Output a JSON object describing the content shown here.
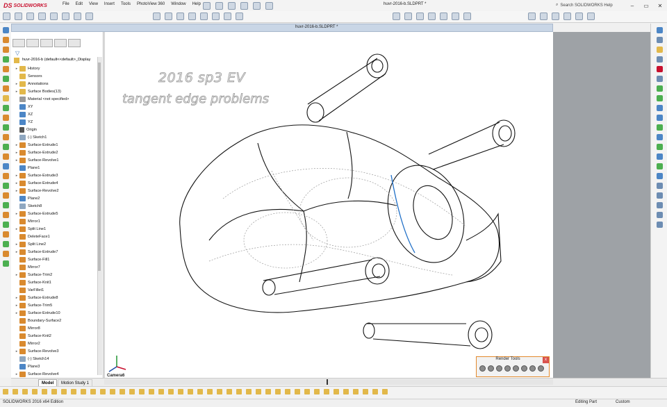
{
  "app": {
    "brand": "SOLIDWORKS",
    "brand_mark": "DS",
    "file_title": "huvr-2016-b.SLDPRT *"
  },
  "menu": [
    "File",
    "Edit",
    "View",
    "Insert",
    "Tools",
    "PhotoView 360",
    "Window",
    "Help"
  ],
  "search": {
    "placeholder": "Search SOLIDWORKS Help"
  },
  "window_controls": {
    "minimize": "–",
    "restore": "▭",
    "close": "✕"
  },
  "document": {
    "title": "huvr-2016-b.SLDPRT *"
  },
  "feature_tree": {
    "root": "huvr-2016-b (default<<default>_Display",
    "items": [
      {
        "label": "History",
        "icon": "folder",
        "expand": "▸"
      },
      {
        "label": "Sensors",
        "icon": "folder",
        "expand": ""
      },
      {
        "label": "Annotations",
        "icon": "folder",
        "expand": "▸"
      },
      {
        "label": "Surface Bodies(13)",
        "icon": "folder",
        "expand": "▸"
      },
      {
        "label": "Material <not specified>",
        "icon": "other",
        "expand": ""
      },
      {
        "label": "XY",
        "icon": "plane",
        "expand": ""
      },
      {
        "label": "XZ",
        "icon": "plane",
        "expand": ""
      },
      {
        "label": "YZ",
        "icon": "plane",
        "expand": ""
      },
      {
        "label": "Origin",
        "icon": "origin",
        "expand": ""
      },
      {
        "label": "(-) Sketch1",
        "icon": "sketch",
        "expand": ""
      },
      {
        "label": "Surface-Extrude1",
        "icon": "feat",
        "expand": "▸"
      },
      {
        "label": "Surface-Extrude2",
        "icon": "feat",
        "expand": "▸"
      },
      {
        "label": "Surface-Revolve1",
        "icon": "feat",
        "expand": "▸"
      },
      {
        "label": "Plane1",
        "icon": "plane",
        "expand": ""
      },
      {
        "label": "Surface-Extrude3",
        "icon": "feat",
        "expand": "▸"
      },
      {
        "label": "Surface-Extrude4",
        "icon": "feat",
        "expand": "▸"
      },
      {
        "label": "Surface-Revolve2",
        "icon": "feat",
        "expand": "▸"
      },
      {
        "label": "Plane2",
        "icon": "plane",
        "expand": ""
      },
      {
        "label": "Sketch8",
        "icon": "sketch",
        "expand": ""
      },
      {
        "label": "Surface-Extrude5",
        "icon": "feat",
        "expand": "▸"
      },
      {
        "label": "Mirror1",
        "icon": "feat",
        "expand": ""
      },
      {
        "label": "Split Line1",
        "icon": "feat",
        "expand": "▸"
      },
      {
        "label": "DeleteFace1",
        "icon": "feat",
        "expand": ""
      },
      {
        "label": "Split Line2",
        "icon": "feat",
        "expand": "▸"
      },
      {
        "label": "Surface-Extrude7",
        "icon": "feat",
        "expand": "▸"
      },
      {
        "label": "Surface-Fill1",
        "icon": "feat",
        "expand": ""
      },
      {
        "label": "Mirror7",
        "icon": "feat",
        "expand": ""
      },
      {
        "label": "Surface-Trim2",
        "icon": "feat",
        "expand": "▸"
      },
      {
        "label": "Surface-Knit1",
        "icon": "feat",
        "expand": ""
      },
      {
        "label": "VarFillet1",
        "icon": "feat",
        "expand": ""
      },
      {
        "label": "Surface-Extrude8",
        "icon": "feat",
        "expand": "▸"
      },
      {
        "label": "Surface-Trim5",
        "icon": "feat",
        "expand": "▸"
      },
      {
        "label": "Surface-Extrude10",
        "icon": "feat",
        "expand": "▸"
      },
      {
        "label": "Boundary-Surface2",
        "icon": "feat",
        "expand": ""
      },
      {
        "label": "Mirror8",
        "icon": "feat",
        "expand": ""
      },
      {
        "label": "Surface-Knit2",
        "icon": "feat",
        "expand": ""
      },
      {
        "label": "Mirror2",
        "icon": "feat",
        "expand": ""
      },
      {
        "label": "Surface-Revolve3",
        "icon": "feat",
        "expand": "▸"
      },
      {
        "label": "(-) Sketch14",
        "icon": "sketch",
        "expand": ""
      },
      {
        "label": "Plane3",
        "icon": "plane",
        "expand": ""
      },
      {
        "label": "Surface-Revolve4",
        "icon": "feat",
        "expand": "▸"
      }
    ]
  },
  "viewport": {
    "watermark_line1": "2016 sp3 EV",
    "watermark_line2": "tangent edge problems",
    "camera_label": "Camera6"
  },
  "render_tools": {
    "title": "Render Tools",
    "close": "x"
  },
  "bottom_tabs": {
    "model": "Model",
    "motion": "Motion Study 1"
  },
  "status": {
    "left": "SOLIDWORKS 2016 x64 Edition",
    "mode": "Editing Part",
    "units": "Custom"
  },
  "colors": {
    "accent": "#c8102e",
    "render_border": "#e38a2d",
    "selected_edge": "#1f6fc7",
    "viewport_grey": "#9ea2a6"
  }
}
